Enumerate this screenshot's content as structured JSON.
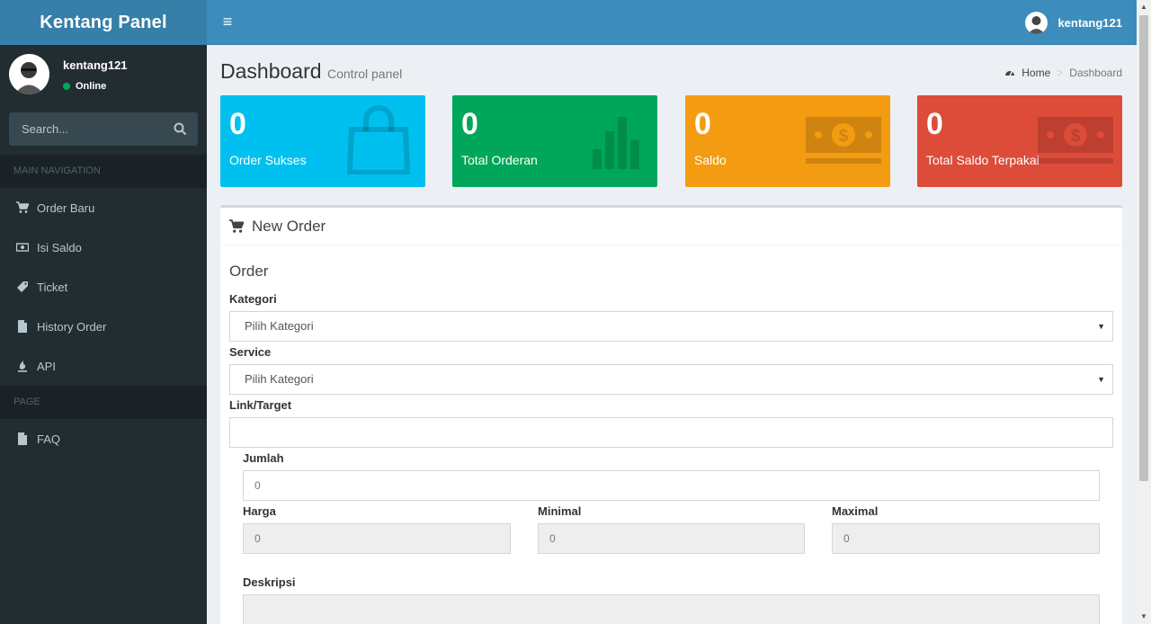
{
  "brand": {
    "logo_text": "Kentang Panel"
  },
  "navbar": {
    "username": "kentang121"
  },
  "sidebar": {
    "user": {
      "name": "kentang121",
      "status": "Online"
    },
    "search": {
      "placeholder": "Search..."
    },
    "headers": [
      "MAIN NAVIGATION",
      "PAGE"
    ],
    "items": [
      {
        "label": "Order Baru",
        "icon": "cart-icon"
      },
      {
        "label": "Isi Saldo",
        "icon": "money-icon"
      },
      {
        "label": "Ticket",
        "icon": "ticket-icon"
      },
      {
        "label": "History Order",
        "icon": "file-icon"
      },
      {
        "label": "API",
        "icon": "fire-icon"
      }
    ],
    "page_items": [
      {
        "label": "FAQ",
        "icon": "file-icon"
      }
    ]
  },
  "page": {
    "title": "Dashboard",
    "subtitle": "Control panel"
  },
  "breadcrumb": {
    "home": "Home",
    "current": "Dashboard"
  },
  "stats": [
    {
      "value": "0",
      "label": "Order Sukses",
      "color": "#00c0ef",
      "icon": "shopping-bag-icon"
    },
    {
      "value": "0",
      "label": "Total Orderan",
      "color": "#00a65a",
      "icon": "bar-chart-icon"
    },
    {
      "value": "0",
      "label": "Saldo",
      "color": "#f39c12",
      "icon": "money-icon"
    },
    {
      "value": "0",
      "label": "Total Saldo Terpakai",
      "color": "#dd4b39",
      "icon": "money-icon"
    }
  ],
  "form": {
    "panel_title": "New Order",
    "section_title": "Order",
    "kategori": {
      "label": "Kategori",
      "value": "Pilih Kategori"
    },
    "service": {
      "label": "Service",
      "value": "Pilih Kategori"
    },
    "link": {
      "label": "Link/Target",
      "value": ""
    },
    "jumlah": {
      "label": "Jumlah",
      "value": "0"
    },
    "harga": {
      "label": "Harga",
      "value": "0"
    },
    "minimal": {
      "label": "Minimal",
      "value": "0"
    },
    "maximal": {
      "label": "Maximal",
      "value": "0"
    },
    "deskripsi": {
      "label": "Deskripsi",
      "value": ""
    }
  }
}
